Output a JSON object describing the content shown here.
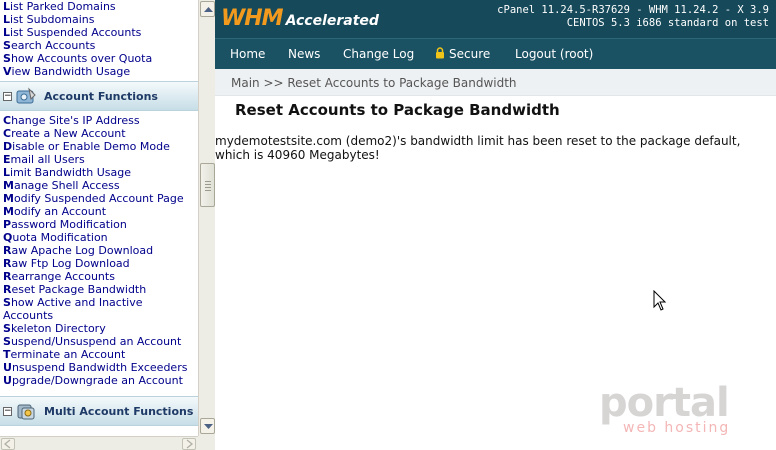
{
  "sidebar": {
    "top_items": [
      {
        "first": "L",
        "rest": "ist Parked Domains"
      },
      {
        "first": "L",
        "rest": "ist Subdomains"
      },
      {
        "first": "L",
        "rest": "ist Suspended Accounts"
      },
      {
        "first": "S",
        "rest": "earch Accounts"
      },
      {
        "first": "S",
        "rest": "how Accounts over Quota"
      },
      {
        "first": "V",
        "rest": "iew Bandwidth Usage"
      }
    ],
    "account_functions_title": "Account Functions",
    "account_items": [
      {
        "first": "C",
        "rest": "hange Site's IP Address"
      },
      {
        "first": "C",
        "rest": "reate a New Account"
      },
      {
        "first": "D",
        "rest": "isable or Enable Demo Mode"
      },
      {
        "first": "E",
        "rest": "mail all Users"
      },
      {
        "first": "L",
        "rest": "imit Bandwidth Usage"
      },
      {
        "first": "M",
        "rest": "anage Shell Access"
      },
      {
        "first": "M",
        "rest": "odify Suspended Account Page"
      },
      {
        "first": "M",
        "rest": "odify an Account"
      },
      {
        "first": "P",
        "rest": "assword Modification"
      },
      {
        "first": "Q",
        "rest": "uota Modification"
      },
      {
        "first": "R",
        "rest": "aw Apache Log Download"
      },
      {
        "first": "R",
        "rest": "aw Ftp Log Download"
      },
      {
        "first": "R",
        "rest": "earrange Accounts"
      },
      {
        "first": "R",
        "rest": "eset Package Bandwidth"
      },
      {
        "first": "S",
        "rest": "how Active and Inactive Accounts"
      },
      {
        "first": "S",
        "rest": "keleton Directory"
      },
      {
        "first": "S",
        "rest": "uspend/Unsuspend an Account"
      },
      {
        "first": "T",
        "rest": "erminate an Account"
      },
      {
        "first": "U",
        "rest": "nsuspend Bandwidth Exceeders"
      },
      {
        "first": "U",
        "rest": "pgrade/Downgrade an Account"
      }
    ],
    "multi_account_title": "Multi Account Functions",
    "toggle_symbol": "−"
  },
  "header": {
    "logo_main": "WHM",
    "logo_sub": "Accelerated",
    "version_line1": "cPanel 11.24.5-R37629 - WHM 11.24.2 - X 3.9",
    "version_line2": "CENTOS 5.3 i686 standard on test"
  },
  "nav": {
    "home": "Home",
    "news": "News",
    "changelog": "Change Log",
    "secure": "Secure",
    "logout": "Logout (root)"
  },
  "breadcrumb": "Main >> Reset Accounts to Package Bandwidth",
  "page_title": "Reset Accounts to Package Bandwidth",
  "message": "mydemotestsite.com (demo2)'s bandwidth limit has been reset to the package default, which is 40960 Megabytes!",
  "watermark": {
    "brand": "portal",
    "tagline": "web hosting"
  },
  "colors": {
    "banner": "#16495a",
    "navbar": "#1a5163",
    "logo_accent": "#f19a1d",
    "link": "#00008b"
  }
}
